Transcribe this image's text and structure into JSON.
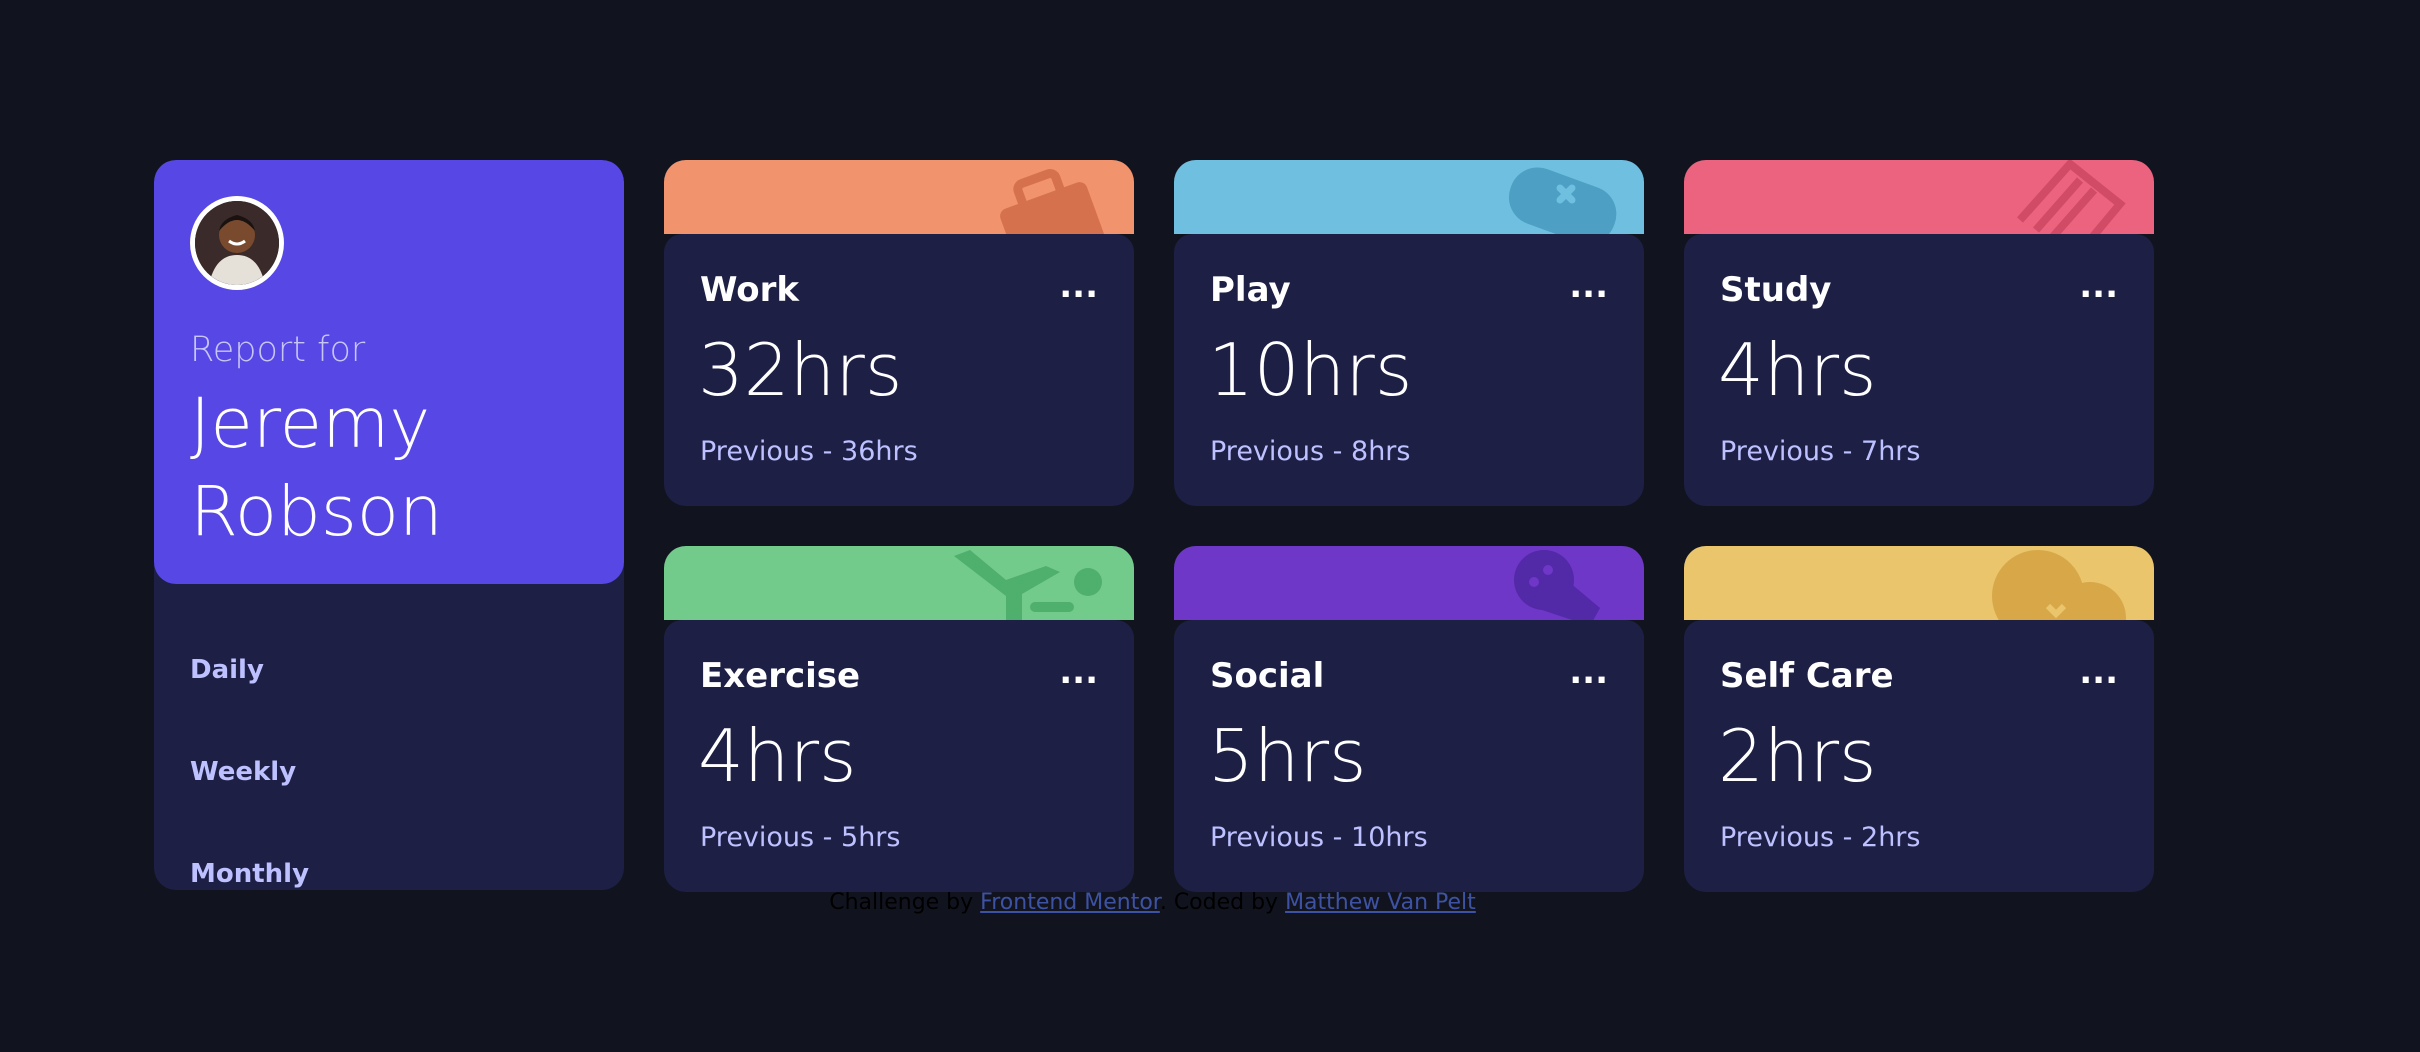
{
  "profile": {
    "report_for": "Report for",
    "name": "Jeremy Robson",
    "avatar_icon": "avatar-photo",
    "periods": [
      "Daily",
      "Weekly",
      "Monthly"
    ],
    "accent": "#5747e5"
  },
  "cards": [
    {
      "title": "Work",
      "current": "32hrs",
      "previous": "Previous - 36hrs",
      "color": "#f1936c",
      "icon": "briefcase-icon",
      "menu": "..."
    },
    {
      "title": "Play",
      "current": "10hrs",
      "previous": "Previous - 8hrs",
      "color": "#6fc0e0",
      "icon": "gamepad-icon",
      "menu": "..."
    },
    {
      "title": "Study",
      "current": "4hrs",
      "previous": "Previous - 7hrs",
      "color": "#eb637e",
      "icon": "book-icon",
      "menu": "..."
    },
    {
      "title": "Exercise",
      "current": "4hrs",
      "previous": "Previous - 5hrs",
      "color": "#72cb8a",
      "icon": "running-icon",
      "menu": "..."
    },
    {
      "title": "Social",
      "current": "5hrs",
      "previous": "Previous - 10hrs",
      "color": "#6f37c8",
      "icon": "chat-bubble-icon",
      "menu": "..."
    },
    {
      "title": "Self Care",
      "current": "2hrs",
      "previous": "Previous - 2hrs",
      "color": "#eac56b",
      "icon": "heart-icon",
      "menu": "..."
    }
  ],
  "attribution": {
    "prefix": "Challenge by",
    "link1": "Frontend Mentor",
    "middle": ". Coded by",
    "link2": "Matthew Van Pelt"
  }
}
